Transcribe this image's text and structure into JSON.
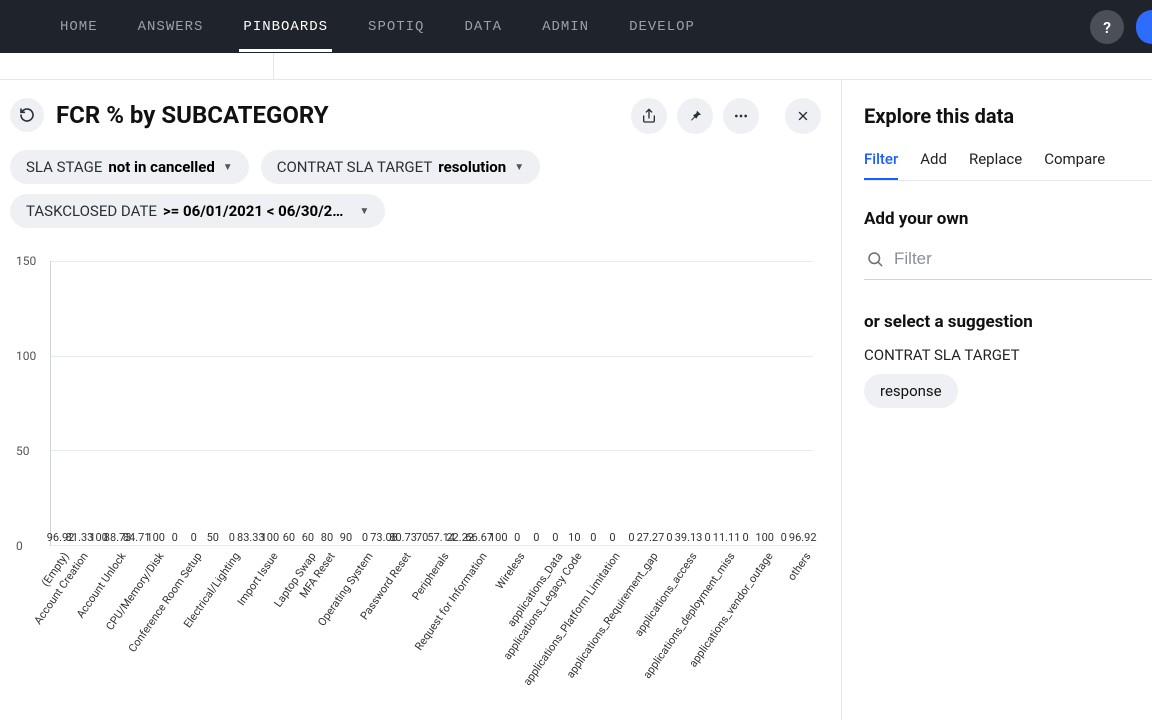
{
  "nav": {
    "items": [
      "HOME",
      "ANSWERS",
      "PINBOARDS",
      "SPOTIQ",
      "DATA",
      "ADMIN",
      "DEVELOP"
    ],
    "active_index": 2,
    "help_glyph": "?"
  },
  "header": {
    "title": "FCR % by SUBCATEGORY"
  },
  "filters": [
    {
      "label": "SLA STAGE",
      "value": "not in cancelled"
    },
    {
      "label": "CONTRAT SLA TARGET",
      "value": "resolution"
    },
    {
      "label": "TASKCLOSED DATE",
      "value": ">= 06/01/2021 < 06/30/2…"
    }
  ],
  "explore": {
    "title": "Explore this data",
    "tabs": [
      "Filter",
      "Add",
      "Replace",
      "Compare"
    ],
    "active_tab_index": 0,
    "add_your_own": "Add your own",
    "filter_placeholder": "Filter",
    "or_select": "or select a suggestion",
    "suggestion_label": "CONTRAT SLA TARGET",
    "suggestion_value": "response"
  },
  "chart_data": {
    "type": "bar",
    "title": "FCR % by SUBCATEGORY",
    "xlabel": "",
    "ylabel": "",
    "ylim": [
      0,
      150
    ],
    "yticks": [
      0,
      50,
      100,
      150
    ],
    "categories": [
      "(Empty)",
      "Account Creation",
      "Account Unlock",
      "CPU/Memory/Disk",
      "Conference Room Setup",
      "Electrical/Lighting",
      "Import Issue",
      "Laptop Swap",
      "MFA Reset",
      "Operating System",
      "Password Reset",
      "Peripherals",
      "Request for Information",
      "Wireless",
      "applications_Data",
      "applications_Legacy Code",
      "applications_Platform Limitation",
      "applications_Requirement_gap",
      "applications_access",
      "applications_deployment_miss",
      "applications_vendor_outage",
      "others"
    ],
    "values": [
      96.92,
      81.33,
      100,
      88.73,
      84.71,
      100,
      0,
      0,
      50,
      0,
      83.33,
      100,
      60,
      60,
      80,
      90,
      0,
      73.08,
      80.73,
      70,
      57.14,
      22.22,
      66.67,
      100,
      0,
      0,
      0,
      10,
      0,
      0,
      0,
      27.27,
      0,
      39.13,
      0,
      11.11,
      0,
      100,
      0,
      96.92
    ],
    "display_values": [
      "96.92",
      "81.33",
      "100",
      "88.73",
      "84.71",
      "100",
      "0",
      "0",
      "50",
      "0",
      "83.33",
      "100",
      "60",
      "60",
      "80",
      "90",
      "0",
      "73.08",
      "80.73",
      "70",
      "57.14",
      "22.22",
      "66.67",
      "100",
      "0",
      "0",
      "0",
      "10",
      "0",
      "0",
      "0",
      "27.27",
      "0",
      "39.13",
      "0",
      "11.11",
      "0",
      "100",
      "0",
      "96.92"
    ]
  }
}
